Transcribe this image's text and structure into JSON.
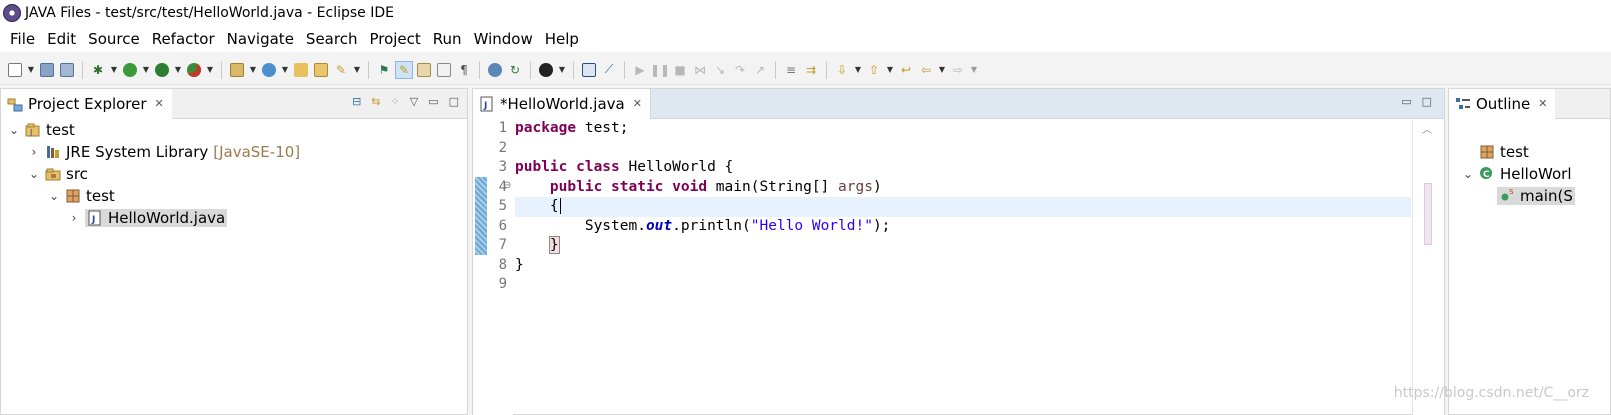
{
  "window": {
    "title": "JAVA Files - test/src/test/HelloWorld.java - Eclipse IDE"
  },
  "menu": [
    "File",
    "Edit",
    "Source",
    "Refactor",
    "Navigate",
    "Search",
    "Project",
    "Run",
    "Window",
    "Help"
  ],
  "project_explorer": {
    "title": "Project Explorer",
    "tree": [
      {
        "label": "test",
        "decoration": "",
        "expanded": true,
        "icon": "project-icon"
      },
      {
        "label": "JRE System Library",
        "decoration": "[JavaSE-10]",
        "expanded": false,
        "icon": "library-icon"
      },
      {
        "label": "src",
        "decoration": "",
        "expanded": true,
        "icon": "source-folder-icon"
      },
      {
        "label": "test",
        "decoration": "",
        "expanded": true,
        "icon": "package-icon"
      },
      {
        "label": "HelloWorld.java",
        "decoration": "",
        "expanded": false,
        "icon": "java-file-icon",
        "selected": true
      }
    ]
  },
  "editor": {
    "tab_label": "*HelloWorld.java",
    "line_numbers": [
      "1",
      "2",
      "3",
      "4",
      "5",
      "6",
      "7",
      "8",
      "9"
    ],
    "current_line": 5,
    "lines": [
      {
        "t1": "package",
        "t2": " test;"
      },
      {},
      {
        "t1": "public class",
        "t2": " HelloWorld {"
      },
      {
        "t0": "    ",
        "t1": "public static void",
        "t2": " main(String[] ",
        "t3": "args",
        "t4": ")"
      },
      {
        "t0": "    {"
      },
      {
        "t0": "        System.",
        "t1": "out",
        "t2": ".println(",
        "t3": "\"Hello World!\"",
        "t4": ");"
      },
      {
        "t0": "    ",
        "t1": "}"
      },
      {
        "t0": "}"
      },
      {}
    ]
  },
  "outline": {
    "title": "Outline",
    "items": [
      "test",
      "HelloWorl",
      "main(S"
    ]
  },
  "watermark": "https://blog.csdn.net/C__orz",
  "colors": {
    "keyword": "#7f0055",
    "string": "#2a00ff",
    "static_field": "#0000c0",
    "current_line": "#e8f2fe"
  }
}
